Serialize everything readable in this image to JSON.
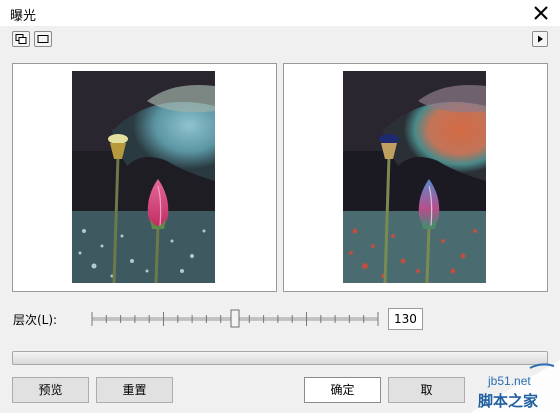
{
  "window": {
    "title": "曝光"
  },
  "toolbar": {
    "dual_view_icon": "dual-preview-icon",
    "single_view_icon": "single-preview-icon",
    "expand_icon": "expand-arrow-icon"
  },
  "slider": {
    "label": "层次(L):",
    "value": "130",
    "position_fraction": 0.5
  },
  "progress": {
    "value_fraction": 0
  },
  "buttons": {
    "preview": "预览",
    "reset": "重置",
    "ok": "确定",
    "cancel": "取"
  },
  "watermark": {
    "site": "jb51.net",
    "name": "脚本之家"
  }
}
